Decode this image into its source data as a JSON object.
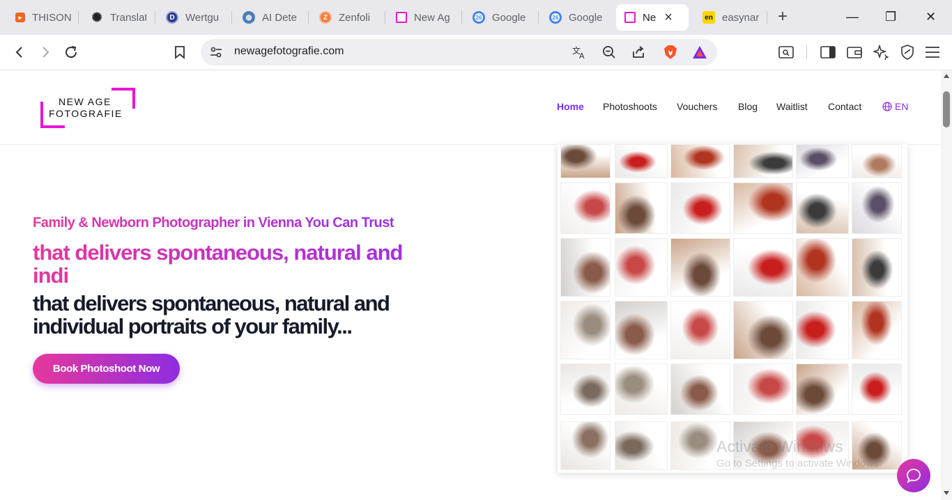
{
  "browser": {
    "tabs": [
      {
        "title": "THISON",
        "favicon": "thison-favicon",
        "color": "#f26522",
        "glyph": "▸"
      },
      {
        "title": "Translat",
        "favicon": "openai-favicon",
        "color": "#222222",
        "glyph": "✺"
      },
      {
        "title": "Wertgu",
        "favicon": "d-favicon",
        "color": "#2b3a8c",
        "glyph": "D"
      },
      {
        "title": "AI Dete",
        "favicon": "globe-favicon",
        "color": "#4a7fb5",
        "glyph": "◍"
      },
      {
        "title": "Zenfoli",
        "favicon": "zenfolio-favicon",
        "color": "#f47c3c",
        "glyph": "Z"
      },
      {
        "title": "New Ag",
        "favicon": "newage-favicon",
        "color": "#e815d6",
        "glyph": "▫"
      },
      {
        "title": "Google",
        "favicon": "google-favicon",
        "color": "#4285f4",
        "glyph": "26"
      },
      {
        "title": "Google",
        "favicon": "google-favicon",
        "color": "#4285f4",
        "glyph": "26"
      },
      {
        "title": "Ne",
        "favicon": "newage-favicon",
        "color": "#e815d6",
        "glyph": "▫",
        "active": true
      },
      {
        "title": "easynar",
        "favicon": "en-favicon",
        "color": "#111111",
        "glyph": "en"
      }
    ],
    "new_tab_glyph": "+",
    "close_glyph": "×",
    "window": {
      "minimize": "—",
      "restore": "❐",
      "close": "✕"
    },
    "url": "newagefotografie.com"
  },
  "site": {
    "logo": {
      "line1": "NEW AGE",
      "line2": "FOTOGRAFIE"
    },
    "nav": {
      "items": [
        "Home",
        "Photoshoots",
        "Vouchers",
        "Blog",
        "Waitlist",
        "Contact"
      ],
      "language": "EN"
    },
    "hero": {
      "subtitle": "Family & Newborn Photographer in Vienna You Can Trust",
      "typed_line": "that delivers spontaneous, natural and indi",
      "headline": "that delivers spontaneous, natural and individual portraits of your family...",
      "cta_label": "Book Photoshoot Now"
    },
    "watermark": {
      "line1": "Activate Windows",
      "line2": "Go to Settings to activate Windows."
    }
  },
  "colors": {
    "brand_magenta": "#e815d6",
    "gradient_start": "#e5389c",
    "gradient_end": "#8e2de2",
    "nav_active": "#7b2ff7",
    "headline": "#161b2a"
  }
}
